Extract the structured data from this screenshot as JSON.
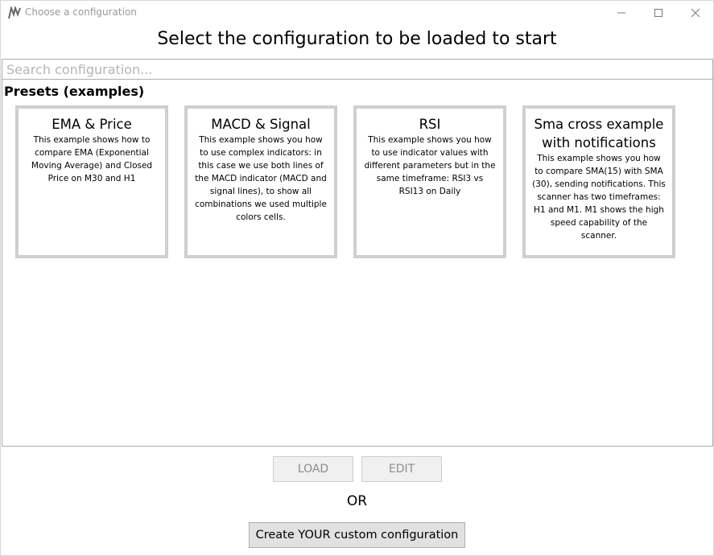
{
  "window": {
    "title": "Choose a configuration",
    "heading": "Select the configuration to be loaded to start"
  },
  "search": {
    "placeholder": "Search configuration...",
    "value": ""
  },
  "presets": {
    "title": "Presets (examples)",
    "cards": [
      {
        "title": "EMA & Price",
        "description": "This example shows how to compare EMA (Exponential Moving Average) and Closed Price on M30 and H1"
      },
      {
        "title": "MACD & Signal",
        "description": "This example shows you how to use complex indicators: in this case we use both lines of the MACD indicator (MACD and signal lines), to show all combinations we used multiple colors cells."
      },
      {
        "title": "RSI",
        "description": "This example shows you how to use indicator values with different parameters but in the same timeframe: RSI3 vs RSI13 on Daily"
      },
      {
        "title": "Sma cross example with notifications",
        "description": "This example shows you how to compare SMA(15) with SMA (30), sending notifications. This scanner has two timeframes: H1 and M1. M1 shows the high speed capability of the scanner."
      }
    ]
  },
  "actions": {
    "load_label": "LOAD",
    "edit_label": "EDIT",
    "or_label": "OR",
    "create_label": "Create YOUR custom configuration"
  }
}
